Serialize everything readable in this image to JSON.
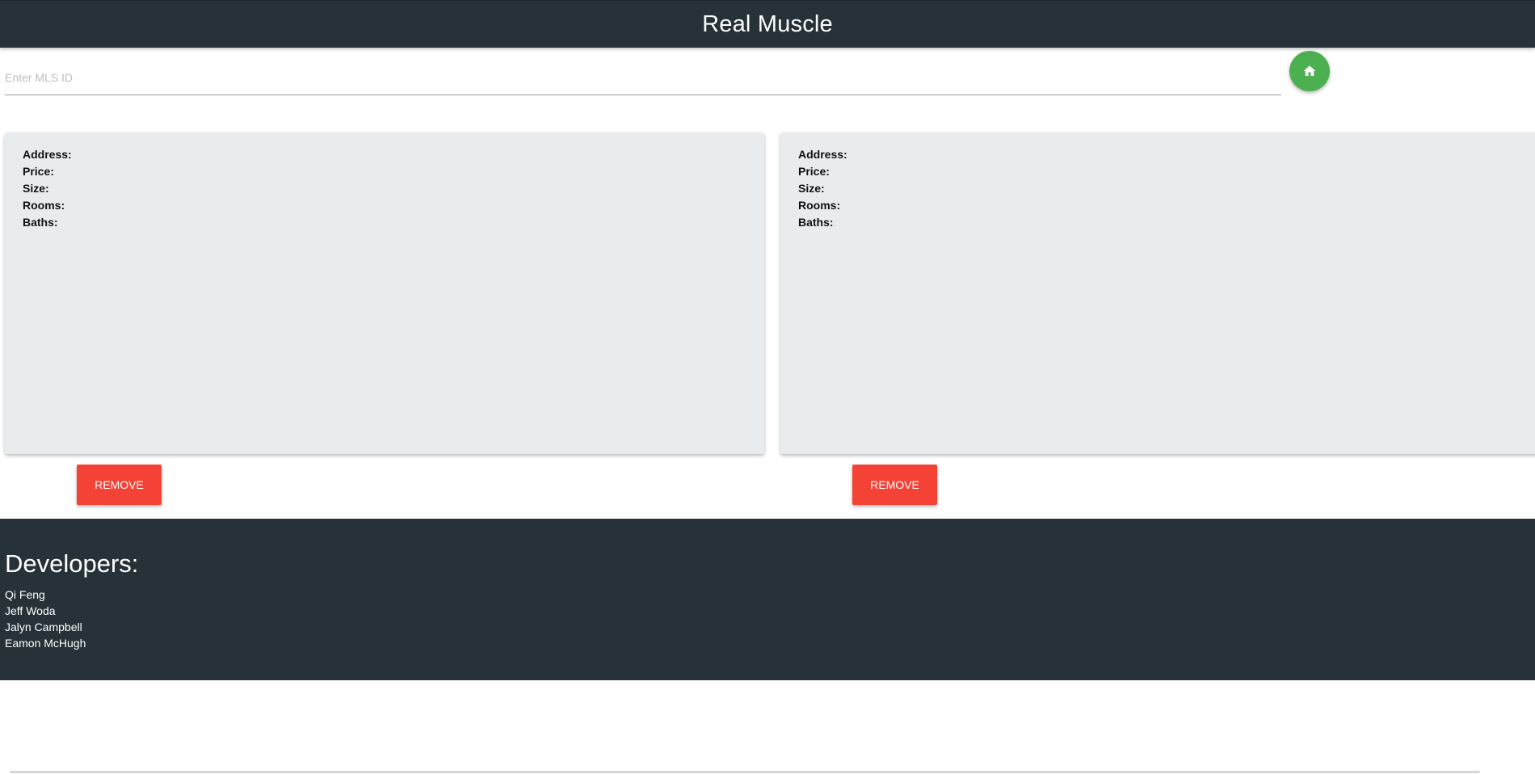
{
  "header": {
    "title": "Real Muscle"
  },
  "search": {
    "placeholder": "Enter MLS ID",
    "value": ""
  },
  "home_button": {
    "icon": "home-icon",
    "color": "#4caf50"
  },
  "cards": [
    {
      "fields": [
        "Address:",
        "Price:",
        "Size:",
        "Rooms:",
        "Baths:"
      ],
      "remove_label": "REMOVE"
    },
    {
      "fields": [
        "Address:",
        "Price:",
        "Size:",
        "Rooms:",
        "Baths:"
      ],
      "remove_label": "REMOVE"
    }
  ],
  "footer": {
    "heading": "Developers:",
    "developers": [
      "Qi Feng",
      "Jeff Woda",
      "Jalyn Campbell",
      "Eamon McHugh"
    ]
  },
  "colors": {
    "header_bg": "#263238",
    "card_bg": "#e9ecef",
    "remove_button": "#f44336"
  }
}
